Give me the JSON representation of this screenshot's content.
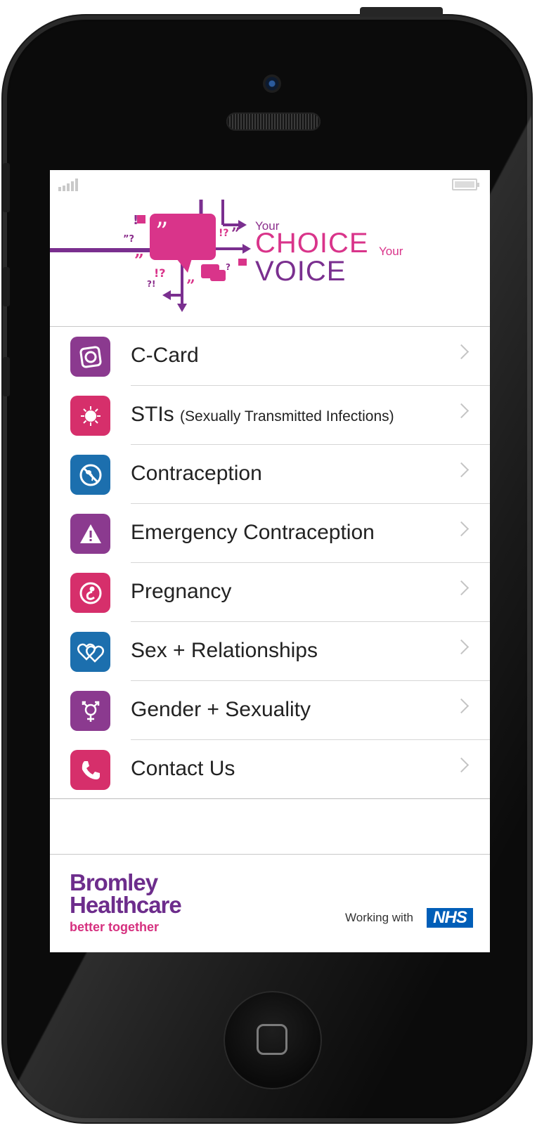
{
  "banner": {
    "logo_line1": "Your",
    "logo_line2": "CHOICE",
    "logo_line3": "Your",
    "logo_line4": "VOICE"
  },
  "menu": {
    "items": [
      {
        "label": "C-Card",
        "icon": "condom-card-icon",
        "color": "#8b3a8f"
      },
      {
        "label": "STIs",
        "sub": "(Sexually Transmitted Infections)",
        "icon": "virus-icon",
        "color": "#d62f6b"
      },
      {
        "label": "Contraception",
        "icon": "no-sperm-icon",
        "color": "#1c6fae"
      },
      {
        "label": "Emergency Contraception",
        "icon": "warning-icon",
        "color": "#8b3a8f"
      },
      {
        "label": "Pregnancy",
        "icon": "baby-icon",
        "color": "#d62f6b"
      },
      {
        "label": "Sex + Relationships",
        "icon": "hearts-icon",
        "color": "#1c6fae"
      },
      {
        "label": "Gender + Sexuality",
        "icon": "gender-symbol-icon",
        "color": "#8b3a8f"
      },
      {
        "label": "Contact Us",
        "icon": "phone-icon",
        "color": "#d62f6b"
      }
    ]
  },
  "footer": {
    "brand_line1": "Bromley",
    "brand_line2": "Healthcare",
    "tagline": "better together",
    "working_with": "Working with",
    "nhs_logo": "NHS"
  },
  "colors": {
    "purple": "#8b3a8f",
    "pink": "#d62f6b",
    "blue": "#1c6fae",
    "nhs_blue": "#005eb8"
  }
}
